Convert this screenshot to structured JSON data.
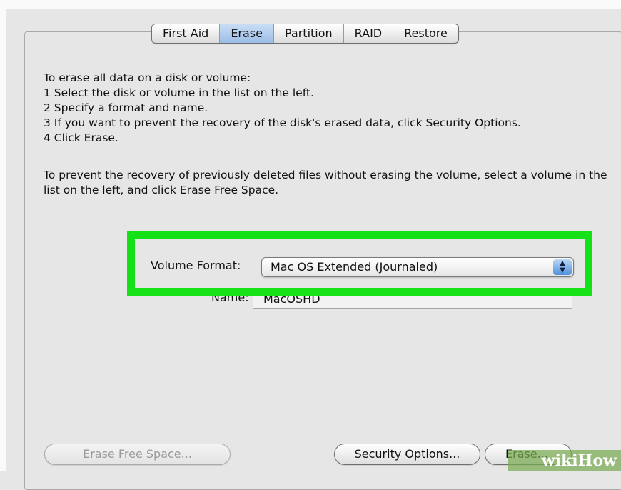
{
  "tabs": [
    "First Aid",
    "Erase",
    "Partition",
    "RAID",
    "Restore"
  ],
  "active_tab": "Erase",
  "instructions": [
    "To erase all data on a disk or volume:",
    "1 Select the disk or volume in the list on the left.",
    "2 Specify a format and name.",
    "3 If you want to prevent the recovery of the disk's erased data, click Security Options.",
    "4 Click Erase."
  ],
  "note": "To prevent the recovery of previously deleted files without erasing the volume, select a volume in the list on the left, and click Erase Free Space.",
  "volume_format": {
    "label": "Volume Format:",
    "value": "Mac OS Extended (Journaled)"
  },
  "name_field": {
    "label": "Name:",
    "value": "MacOSHD"
  },
  "buttons": {
    "erase_free_space": "Erase Free Space...",
    "security_options": "Security Options...",
    "erase": "Erase..."
  },
  "watermark": "wikiHow",
  "colors": {
    "highlight": "#16e016",
    "active_tab": "#9cbde6",
    "select_arrows": "#4f90dc"
  }
}
